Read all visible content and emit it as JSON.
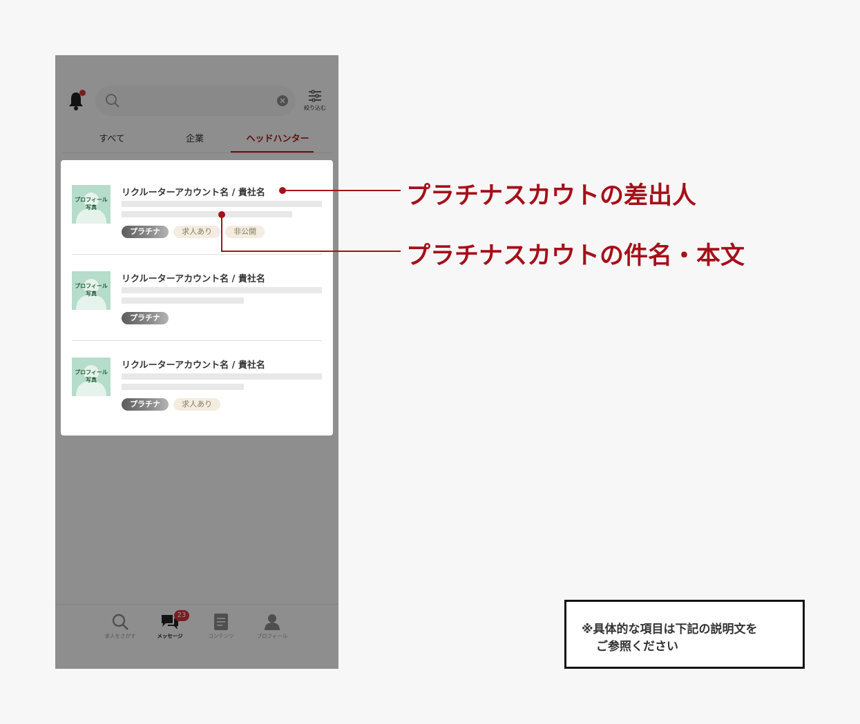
{
  "search": {
    "placeholder": ""
  },
  "filter": {
    "label": "絞り込む"
  },
  "tabs": [
    {
      "label": "すべて"
    },
    {
      "label": "企業"
    },
    {
      "label": "ヘッドハンター"
    }
  ],
  "messages": [
    {
      "avatar_text_1": "プロフィール",
      "avatar_text_2": "写真",
      "sender": "リクルーターアカウント名 / 貴社名",
      "tags": [
        "プラチナ",
        "求人あり",
        "非公開"
      ]
    },
    {
      "avatar_text_1": "プロフィール",
      "avatar_text_2": "写真",
      "sender": "リクルーターアカウント名 / 貴社名",
      "tags": [
        "プラチナ"
      ]
    },
    {
      "avatar_text_1": "プロフィール",
      "avatar_text_2": "写真",
      "sender": "リクルーターアカウント名 / 貴社名",
      "tags": [
        "プラチナ",
        "求人あり"
      ]
    }
  ],
  "bottom_nav": [
    {
      "label": "求人をさがす",
      "icon": "search-icon"
    },
    {
      "label": "メッセージ",
      "icon": "chat-icon",
      "badge": "23"
    },
    {
      "label": "コンテンツ",
      "icon": "document-icon"
    },
    {
      "label": "プロフィール",
      "icon": "person-icon"
    }
  ],
  "annotations": {
    "sender": "プラチナスカウトの差出人",
    "subject": "プラチナスカウトの件名・本文"
  },
  "note": {
    "line1": "※具体的な項目は下記の説明文を",
    "line2": "ご参照ください"
  },
  "colors": {
    "accent": "#a5101a",
    "badge": "#d3313a",
    "avatar_bg": "#b6dccb",
    "tag_beige": "#f3ece0"
  }
}
